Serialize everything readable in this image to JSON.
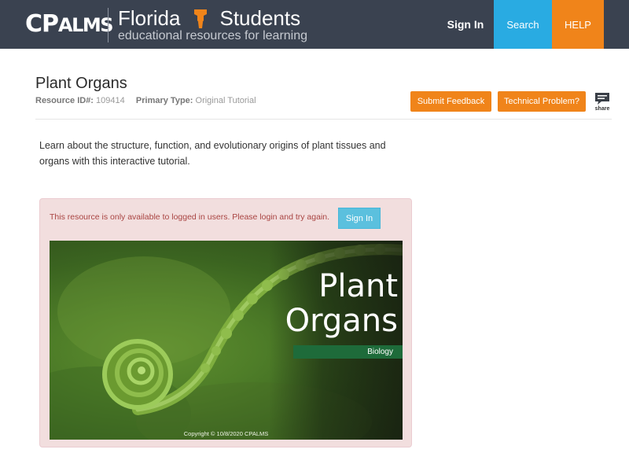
{
  "header": {
    "logo_main": "CP",
    "logo_rest": "ALMS",
    "brand_florida": "Florida",
    "brand_students": "Students",
    "brand_tagline": "educational resources for learning",
    "nav": {
      "signin": "Sign In",
      "search": "Search",
      "help": "HELP"
    }
  },
  "resource": {
    "title": "Plant Organs",
    "id_label": "Resource ID#:",
    "id_value": "109414",
    "type_label": "Primary Type:",
    "type_value": "Original Tutorial",
    "submit_feedback": "Submit Feedback",
    "technical_problem": "Technical Problem?",
    "share_label": "share",
    "description": "Learn about the structure, function, and evolutionary origins of plant tissues and organs with this interactive tutorial."
  },
  "alert": {
    "message": "This resource is only available to logged in users. Please login and try again.",
    "signin_button": "Sign In"
  },
  "hero": {
    "title_line1": "Plant",
    "title_line2": "Organs",
    "subject": "Biology",
    "copyright": "Copyright © 10/8/2020 CPALMS"
  },
  "colors": {
    "header_bg": "#3a4250",
    "search_blue": "#29abe2",
    "help_orange": "#f0841a",
    "alert_bg": "#f2dede",
    "alert_text": "#a94442",
    "signin_blue": "#5bc0de",
    "biology_band": "#1e6b3a"
  },
  "icons": [
    "florida-student-icon",
    "share-comment-icon",
    "fern-fiddlehead-image"
  ]
}
